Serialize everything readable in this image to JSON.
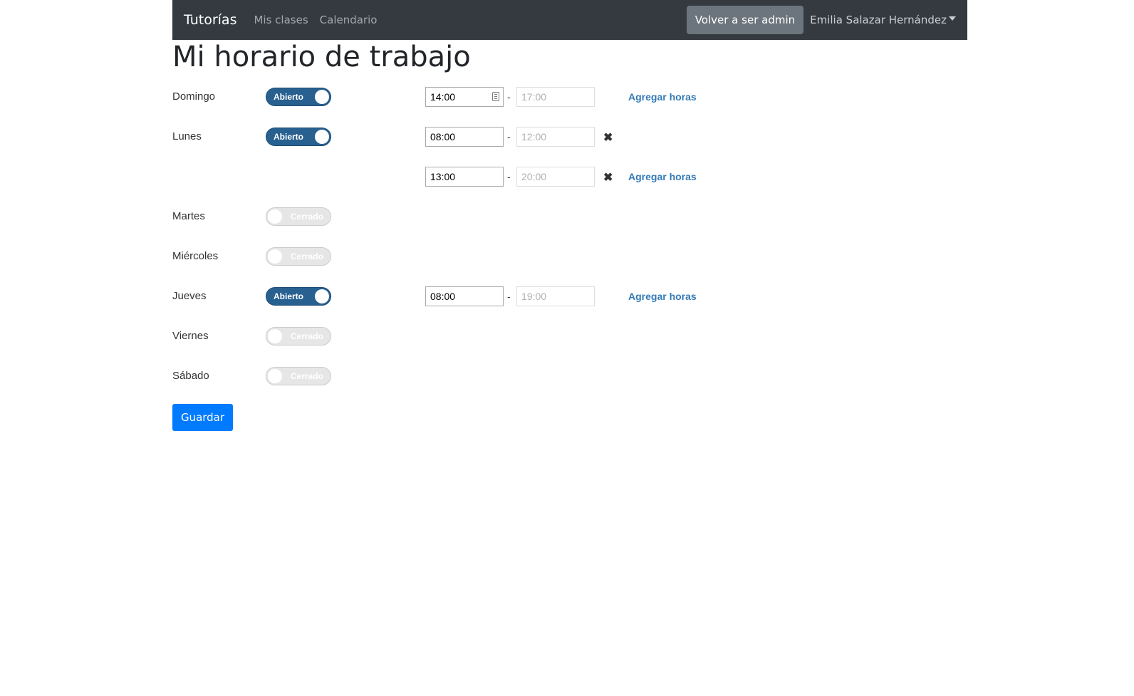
{
  "navbar": {
    "brand": "Tutorías",
    "links": [
      "Mis clases",
      "Calendario"
    ],
    "admin_button": "Volver a ser admin",
    "user_name": "Emilia Salazar Hernández"
  },
  "page_title": "Mi horario de trabajo",
  "toggle_labels": {
    "open": "Abierto",
    "closed": "Cerrado"
  },
  "add_hours_label": "Agregar horas",
  "dash": "-",
  "days": [
    {
      "name": "Domingo",
      "open": true,
      "slots": [
        {
          "start": "14:00",
          "end": "17:00"
        }
      ]
    },
    {
      "name": "Lunes",
      "open": true,
      "slots": [
        {
          "start": "08:00",
          "end": "12:00"
        },
        {
          "start": "13:00",
          "end": "20:00"
        }
      ]
    },
    {
      "name": "Martes",
      "open": false,
      "slots": []
    },
    {
      "name": "Miércoles",
      "open": false,
      "slots": []
    },
    {
      "name": "Jueves",
      "open": true,
      "slots": [
        {
          "start": "08:00",
          "end": "19:00"
        }
      ]
    },
    {
      "name": "Viernes",
      "open": false,
      "slots": []
    },
    {
      "name": "Sábado",
      "open": false,
      "slots": []
    }
  ],
  "save_button": "Guardar",
  "colors": {
    "navbar_bg": "#343a40",
    "toggle_on": "#286090",
    "link": "#337ab7",
    "primary": "#007bff"
  }
}
